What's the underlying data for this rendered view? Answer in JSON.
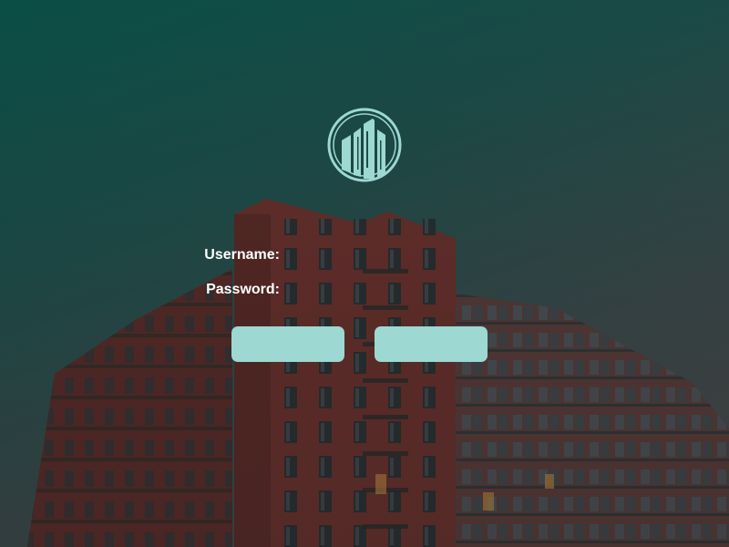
{
  "login": {
    "username_label": "Username:",
    "password_label": "Password:",
    "username_value": "",
    "password_value": "",
    "primary_button_label": "",
    "secondary_button_label": ""
  },
  "icons": {
    "logo": "building-logo-icon"
  },
  "colors": {
    "background_teal": "#0a4f47",
    "background_gray": "#4f4446",
    "button_fill": "#9dd8d2",
    "logo_color": "#9dd8d2",
    "label_text": "#ffffff",
    "building_brick": "#5a2320"
  }
}
